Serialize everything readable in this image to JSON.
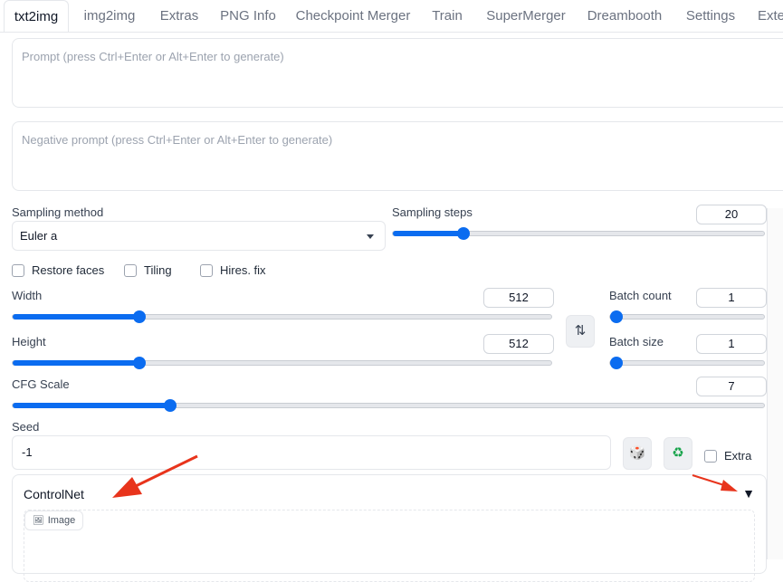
{
  "tabs": [
    {
      "label": "txt2img",
      "active": true
    },
    {
      "label": "img2img"
    },
    {
      "label": "Extras"
    },
    {
      "label": "PNG Info"
    },
    {
      "label": "Checkpoint Merger"
    },
    {
      "label": "Train"
    },
    {
      "label": "SuperMerger"
    },
    {
      "label": "Dreambooth"
    },
    {
      "label": "Settings"
    },
    {
      "label": "Exte"
    }
  ],
  "prompt": {
    "placeholder": "Prompt (press Ctrl+Enter or Alt+Enter to generate)"
  },
  "negative_prompt": {
    "placeholder": "Negative prompt (press Ctrl+Enter or Alt+Enter to generate)"
  },
  "sampling_method": {
    "label": "Sampling method",
    "value": "Euler a"
  },
  "sampling_steps": {
    "label": "Sampling steps",
    "value": "20",
    "fraction": 0.19
  },
  "checkboxes": {
    "restore_faces": "Restore faces",
    "tiling": "Tiling",
    "hires_fix": "Hires. fix"
  },
  "width": {
    "label": "Width",
    "value": "512",
    "fraction": 0.235
  },
  "height": {
    "label": "Height",
    "value": "512",
    "fraction": 0.235
  },
  "batch_count": {
    "label": "Batch count",
    "value": "1",
    "fraction": 0.0
  },
  "batch_size": {
    "label": "Batch size",
    "value": "1",
    "fraction": 0.0
  },
  "cfg_scale": {
    "label": "CFG Scale",
    "value": "7",
    "fraction": 0.21
  },
  "seed": {
    "label": "Seed",
    "value": "-1",
    "extra_label": "Extra"
  },
  "controlnet": {
    "title": "ControlNet",
    "image_chip": "Image",
    "toggle": "▼"
  },
  "icons": {
    "swap": "swap-dimensions-icon",
    "dice": "dice-icon",
    "recycle": "recycle-icon"
  },
  "colors": {
    "accent": "#0b6cf0",
    "arrow": "#e8341c"
  }
}
